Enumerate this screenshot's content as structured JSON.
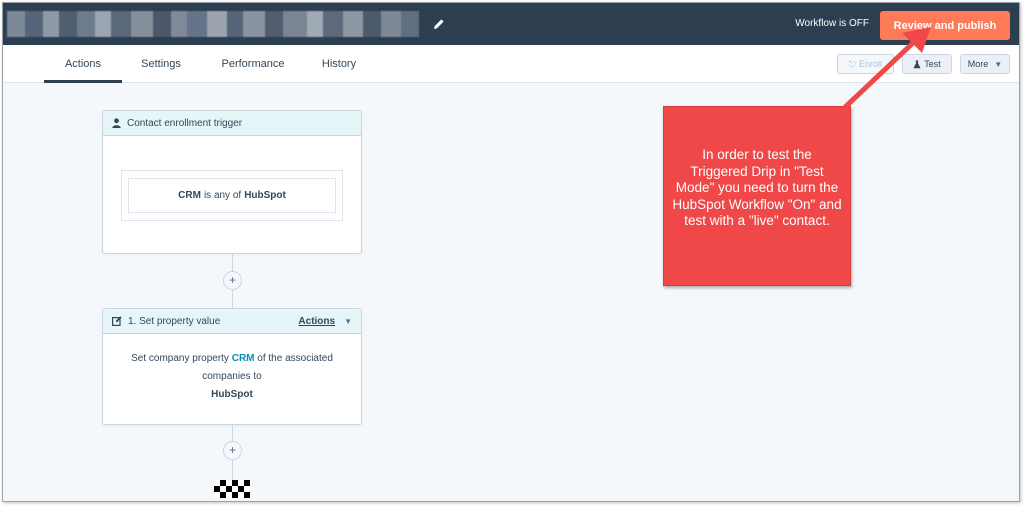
{
  "header": {
    "workflow_status": "Workflow is OFF",
    "publish_label": "Review and publish"
  },
  "tabs": [
    {
      "label": "Actions",
      "active": true
    },
    {
      "label": "Settings",
      "active": false
    },
    {
      "label": "Performance",
      "active": false
    },
    {
      "label": "History",
      "active": false
    }
  ],
  "toolbar": {
    "enroll_label": "Enroll",
    "test_label": "Test",
    "more_label": "More"
  },
  "trigger": {
    "title": "Contact enrollment trigger",
    "filter": {
      "property": "CRM",
      "operator": "is any of",
      "value": "HubSpot"
    }
  },
  "action_1": {
    "title": "1. Set property value",
    "actions_label": "Actions",
    "body_prefix": "Set company property",
    "property": "CRM",
    "body_suffix": "of the associated companies to",
    "value": "HubSpot"
  },
  "callout": {
    "text": "In order to test the Triggered Drip in \"Test Mode\" you need to turn the HubSpot Workflow \"On\" and test with a \"live\" contact."
  },
  "colors": {
    "topbar": "#2d3e50",
    "publish": "#ff7a59",
    "callout": "#f04848",
    "teal": "#0091ae"
  }
}
